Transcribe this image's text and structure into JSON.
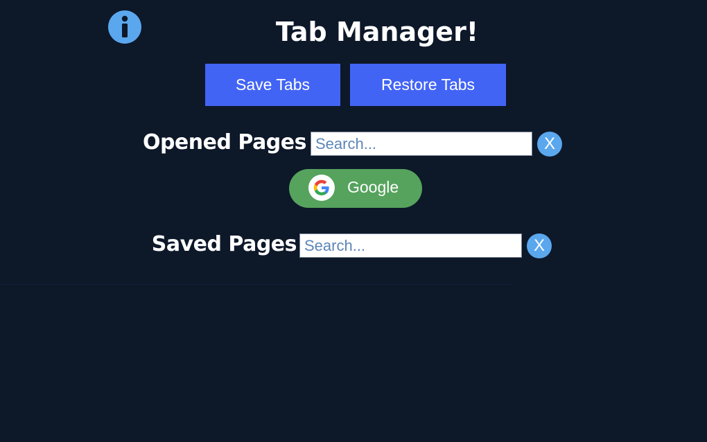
{
  "app": {
    "title": "Tab Manager!"
  },
  "toolbar": {
    "save_label": "Save Tabs",
    "restore_label": "Restore Tabs"
  },
  "opened": {
    "label": "Opened Pages",
    "search_placeholder": "Search...",
    "clear_label": "X",
    "tabs": [
      {
        "label": "Google",
        "icon": "google-icon"
      }
    ]
  },
  "saved": {
    "label": "Saved Pages",
    "search_placeholder": "Search...",
    "clear_label": "X"
  },
  "colors": {
    "background": "#0d1829",
    "button_blue": "#4264f5",
    "chip_green": "#56a35d",
    "clear_blue": "#5aa7ee",
    "info_blue": "#5aa7ee"
  }
}
